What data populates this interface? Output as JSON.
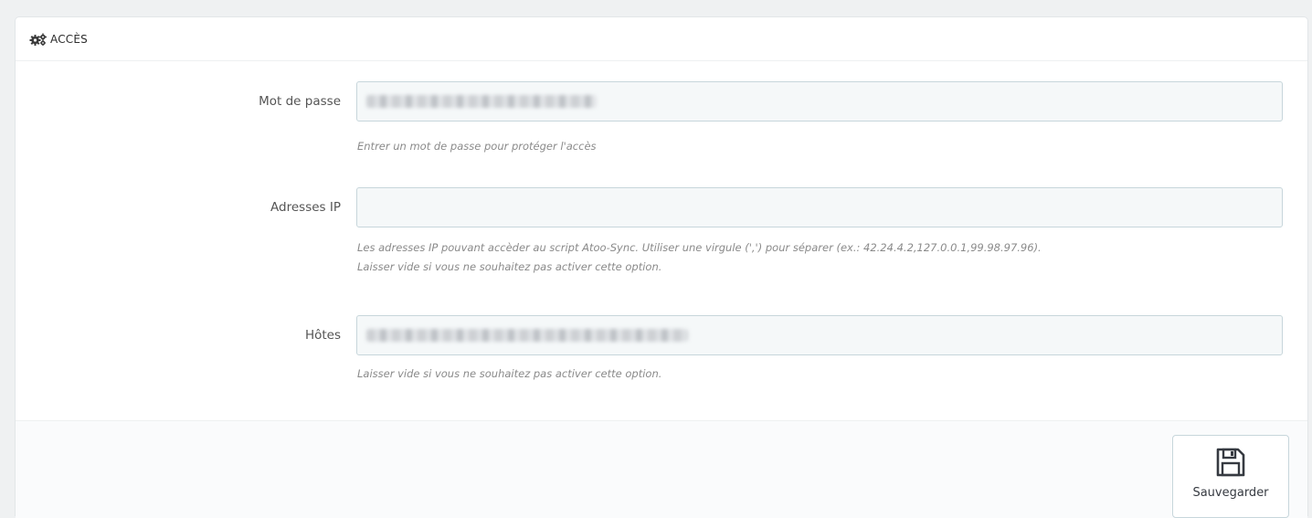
{
  "panel": {
    "title": "ACCÈS",
    "title_icon": "cogs-icon"
  },
  "fields": {
    "password": {
      "label": "Mot de passe",
      "help": "Entrer un mot de passe pour protéger l'accès",
      "value_obscured": true
    },
    "ip": {
      "label": "Adresses IP",
      "value": "",
      "help_line1": "Les adresses IP pouvant accèder au script Atoo-Sync. Utiliser une virgule (',') pour séparer (ex.: 42.24.4.2,127.0.0.1,99.98.97.96).",
      "help_line2": "Laisser vide si vous ne souhaitez pas activer cette option."
    },
    "hosts": {
      "label": "Hôtes",
      "help": "Laisser vide si vous ne souhaitez pas activer cette option.",
      "value_obscured": true
    }
  },
  "footer": {
    "save_label": "Sauvegarder",
    "save_icon": "floppy-disk-icon"
  },
  "colors": {
    "input_bg": "#f5f8f9",
    "input_border": "#c7d6db",
    "help_text": "#8a8a8a"
  }
}
